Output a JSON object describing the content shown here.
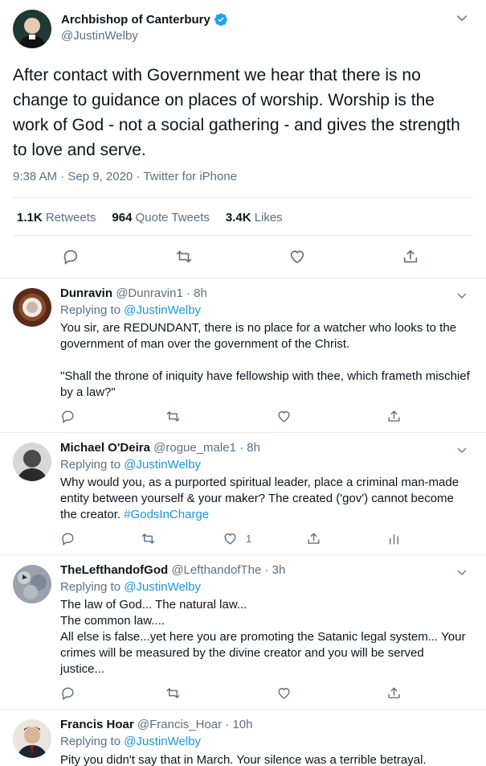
{
  "main_tweet": {
    "author_name": "Archbishop of Canterbury",
    "handle": "@JustinWelby",
    "verified_icon": "verified-badge-icon",
    "text": "After contact with Government we hear that there is no change to guidance on places of worship. Worship is the work of God - not a social gathering - and gives the strength to love and serve.",
    "meta": "9:38 AM · Sep 9, 2020 · Twitter for iPhone",
    "retweets_count": "1.1K",
    "retweets_label": "Retweets",
    "quotes_count": "964",
    "quotes_label": "Quote Tweets",
    "likes_count": "3.4K",
    "likes_label": "Likes"
  },
  "replies": [
    {
      "name": "Dunravin",
      "handle_time": "@Dunravin1 · 8h",
      "replying_prefix": "Replying to",
      "replying_to": "@JustinWelby",
      "line1": "You sir, are REDUNDANT, there is no place for a watcher who looks to the government of man over the government of the Christ.",
      "line2": "\"Shall the throne of iniquity have fellowship with thee, which frameth mischief by a law?\""
    },
    {
      "name": "Michael O'Deira",
      "handle_time": "@rogue_male1 · 8h",
      "replying_prefix": "Replying to",
      "replying_to": "@JustinWelby",
      "text": "Why would you, as a purported spiritual leader, place a criminal man-made entity between yourself & your maker? The created ('gov') cannot become the creator.",
      "hashtag": "#GodsInCharge",
      "like_count": "1"
    },
    {
      "name": "TheLefthandofGod",
      "handle_time": "@LefthandofThe · 3h",
      "replying_prefix": "Replying to",
      "replying_to": "@JustinWelby",
      "line1": "The law of God... The natural law...",
      "line2": "The common law....",
      "line3": "All else is false...yet here you are promoting the Satanic legal system... Your crimes will be measured by the divine creator and you will be served justice..."
    },
    {
      "name": "Francis Hoar",
      "handle_time": "@Francis_Hoar · 10h",
      "replying_prefix": "Replying to",
      "replying_to": "@JustinWelby",
      "text": "Pity you didn't say that in March. Your silence was a terrible betrayal."
    }
  ],
  "colors": {
    "link": "#1b95e0",
    "muted": "#5b7083",
    "border": "#e6ecf0",
    "text": "#0f1419"
  }
}
